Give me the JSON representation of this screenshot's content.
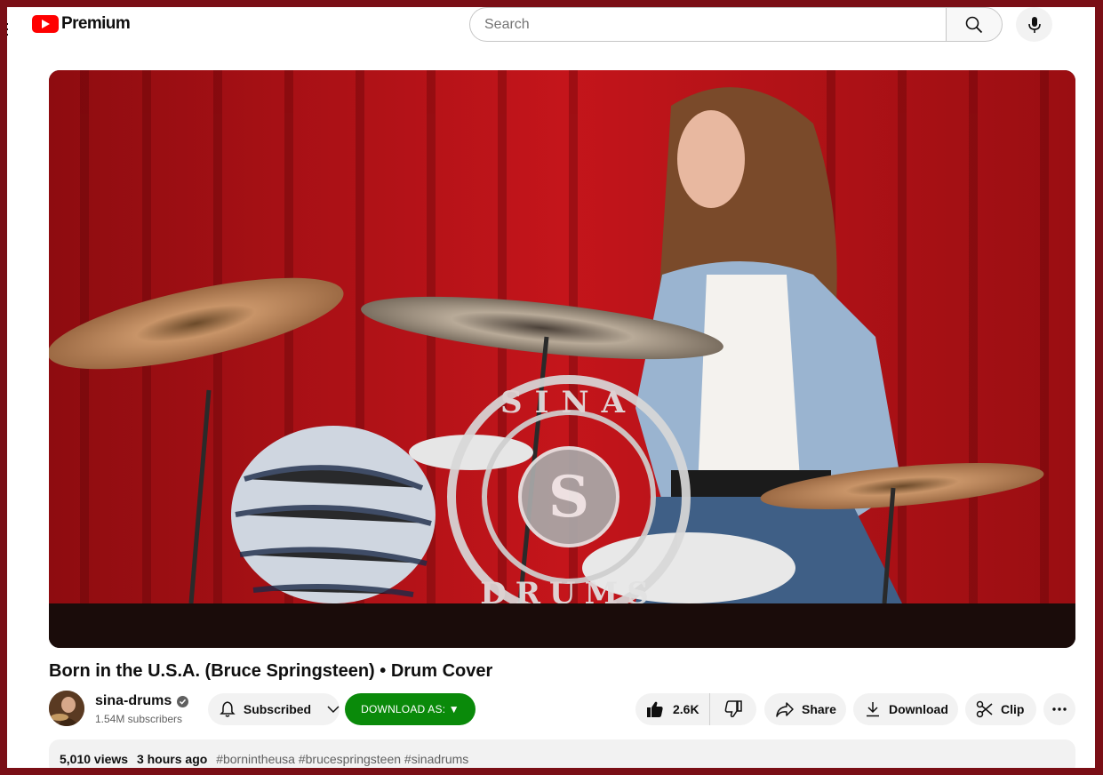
{
  "header": {
    "logo_text": "Premium",
    "search_placeholder": "Search"
  },
  "video": {
    "title": "Born in the U.S.A. (Bruce Springsteen) • Drum Cover",
    "watermark": "SINA DRUMS"
  },
  "channel": {
    "name": "sina-drums",
    "subscribers": "1.54M subscribers"
  },
  "actions": {
    "subscribed_label": "Subscribed",
    "download_as_label": "DOWNLOAD AS: ▼",
    "like_count": "2.6K",
    "share_label": "Share",
    "download_label": "Download",
    "clip_label": "Clip"
  },
  "description": {
    "views": "5,010 views",
    "posted": "3 hours ago",
    "hashtags": "#bornintheusa #brucespringsteen #sinadrums"
  },
  "colors": {
    "frame": "#7a0f16",
    "youtube_red": "#ff0000",
    "download_as_green": "#0a8a0a"
  }
}
